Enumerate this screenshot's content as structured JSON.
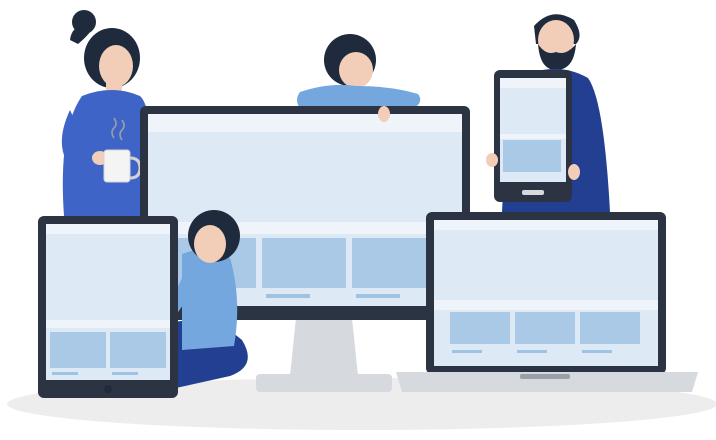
{
  "illustration": {
    "subject": "responsive-devices-with-people",
    "colors": {
      "background": "#ffffff",
      "floor": "#ededed",
      "bezel": "#2c3444",
      "screen": "#dde9f4",
      "screen_header": "#eef4fa",
      "block": "#a9c9e6",
      "line": "#9fc3e4",
      "stand": "#d6d9dd",
      "skin": "#f2cdb8",
      "hair": "#1f2b3c",
      "royal_blue": "#3f64c8",
      "light_blue": "#73a7dd",
      "navy": "#223f92",
      "mug": "#f4f4f4"
    },
    "devices": [
      "desktop-monitor",
      "tablet-left",
      "tablet-right",
      "laptop"
    ],
    "people": [
      "woman-with-mug",
      "person-leaning-on-monitor",
      "bearded-man-holding-tablet",
      "seated-woman-holding-tablet"
    ]
  }
}
